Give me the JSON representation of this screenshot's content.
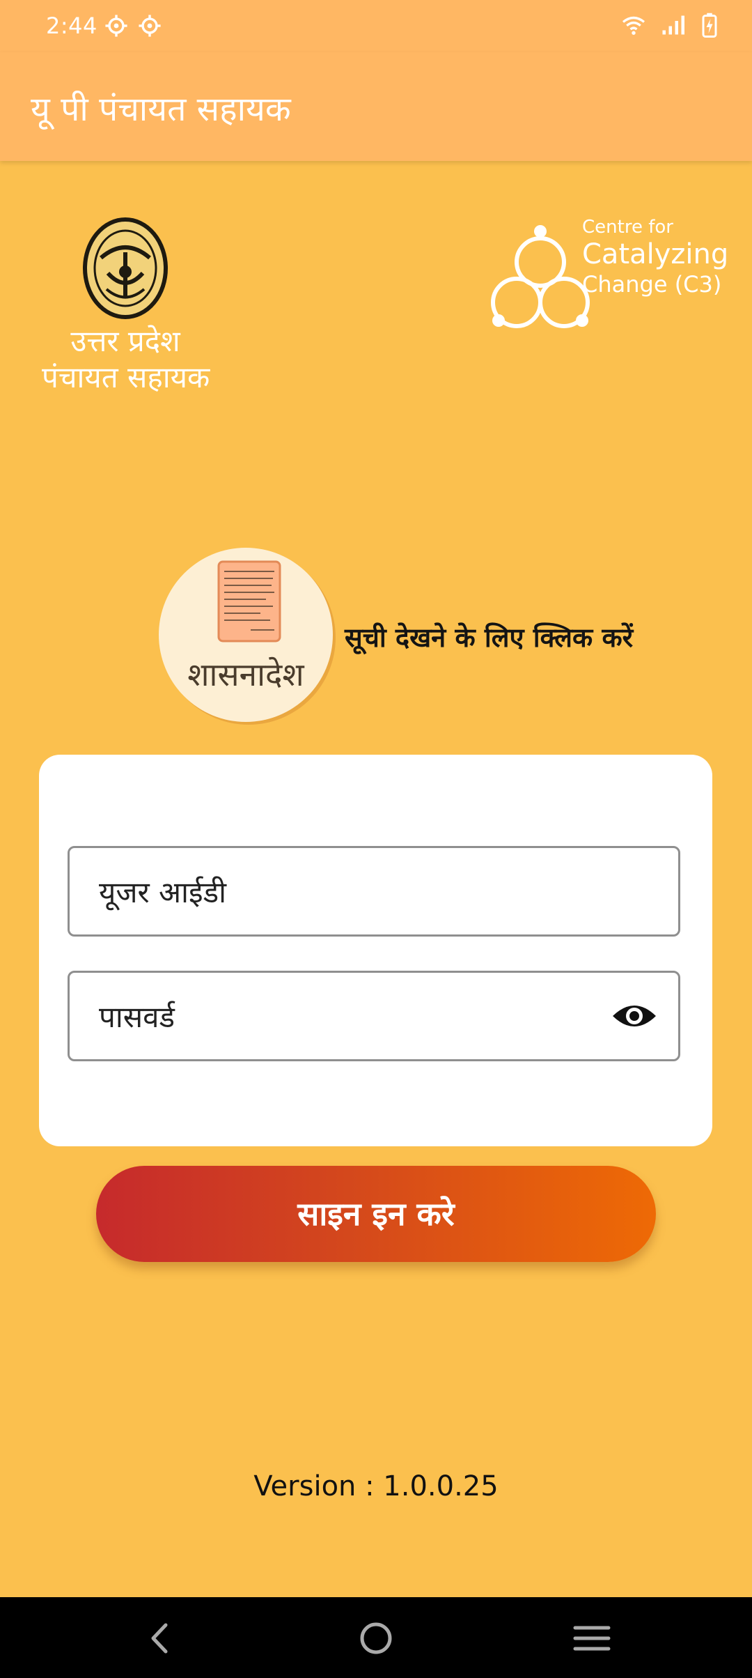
{
  "status_bar": {
    "time": "2:44",
    "icons_left": [
      "gear-icon",
      "gear-icon"
    ],
    "icons_right": [
      "wifi-icon",
      "signal-icon",
      "battery-charging-icon"
    ]
  },
  "app_bar": {
    "title": "यू पी पंचायत सहायक"
  },
  "logos": {
    "up_logo_line1": "उत्तर प्रदेश",
    "up_logo_line2": "पंचायत सहायक",
    "c3_line1": "Centre for",
    "c3_line2": "Catalyzing",
    "c3_line3": "Change (C3)"
  },
  "shasanadesh": {
    "label": "शासनादेश",
    "hint": "सूची देखने के लिए क्लिक करें",
    "icon": "document-icon"
  },
  "login_form": {
    "user_id_placeholder": "यूजर आईडी",
    "password_placeholder": "पासवर्ड",
    "password_toggle_icon": "eye-icon",
    "sign_in_label": "साइन इन करे"
  },
  "version": "Version : 1.0.0.25",
  "colors": {
    "app_bar": "#FFB763",
    "background": "#FBC04E",
    "button_start": "#C62A2C",
    "button_end": "#EE6A05"
  },
  "nav_bar": {
    "icons": [
      "back-icon",
      "home-icon",
      "menu-icon"
    ]
  }
}
